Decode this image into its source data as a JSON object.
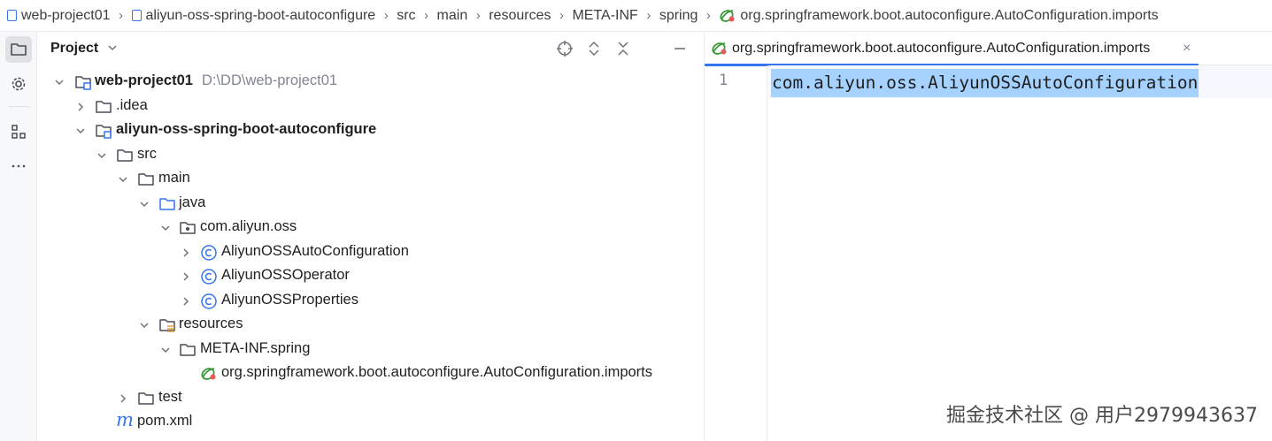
{
  "breadcrumb": [
    "web-project01",
    "aliyun-oss-spring-boot-autoconfigure",
    "src",
    "main",
    "resources",
    "META-INF",
    "spring",
    "org.springframework.boot.autoconfigure.AutoConfiguration.imports"
  ],
  "project_panel": {
    "title": "Project",
    "tree": [
      {
        "label": "web-project01",
        "hint": "D:\\DD\\web-project01"
      },
      {
        "label": ".idea"
      },
      {
        "label": "aliyun-oss-spring-boot-autoconfigure"
      },
      {
        "label": "src"
      },
      {
        "label": "main"
      },
      {
        "label": "java"
      },
      {
        "label": "com.aliyun.oss"
      },
      {
        "label": "AliyunOSSAutoConfiguration"
      },
      {
        "label": "AliyunOSSOperator"
      },
      {
        "label": "AliyunOSSProperties"
      },
      {
        "label": "resources"
      },
      {
        "label": "META-INF.spring"
      },
      {
        "label": "org.springframework.boot.autoconfigure.AutoConfiguration.imports"
      },
      {
        "label": "test"
      },
      {
        "label": "pom.xml"
      }
    ]
  },
  "editor": {
    "tab_label": "org.springframework.boot.autoconfigure.AutoConfiguration.imports",
    "line_number": "1",
    "code": "com.aliyun.oss.AliyunOSSAutoConfiguration"
  },
  "watermark": "掘金技术社区 @ 用户2979943637",
  "colors": {
    "accent": "#3574f0",
    "selection": "#a6d2ff",
    "class_icon": "#3574f0"
  }
}
